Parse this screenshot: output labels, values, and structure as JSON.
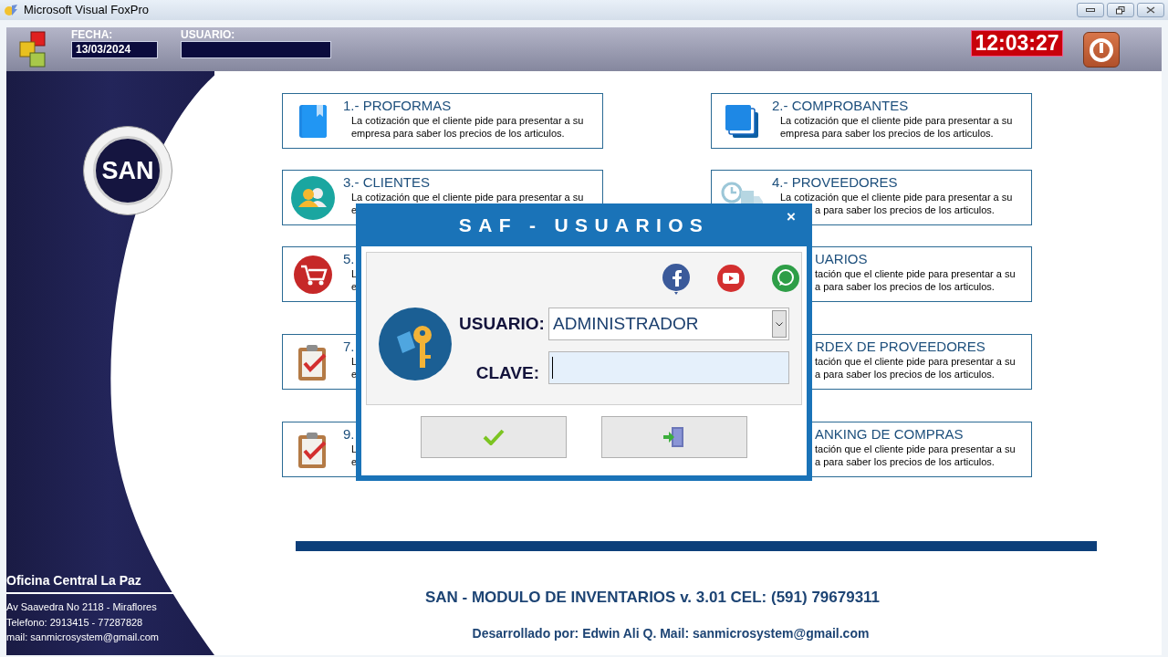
{
  "window": {
    "title": "Microsoft Visual FoxPro"
  },
  "header": {
    "date_label": "FECHA:",
    "date": "13/03/2024",
    "user_label": "USUARIO:",
    "clock": "12:03:27"
  },
  "menu_cards": [
    {
      "title": {
        "text": "1.- PROFORMAS"
      },
      "lines": [
        {
          "text": "La cotización que el cliente pide para presentar a su"
        },
        {
          "text": "empresa para saber los precios de los articulos."
        }
      ]
    },
    {
      "title": {
        "text": "2.- COMPROBANTES",
        "covered": false
      },
      "lines": [
        {
          "text": "La cotización que el cliente pide para presentar a su",
          "covered": false
        },
        {
          "text": "empresa para saber los precios de los articulos.",
          "covered": false
        }
      ]
    },
    {
      "title": {
        "text": "3.- CLIENTES"
      },
      "lines": [
        {
          "text": "La cotización que el cliente pide para presentar a su"
        },
        {
          "text": "e"
        }
      ]
    },
    {
      "title": {
        "text": "4.- PROVEEDORES",
        "covered": false
      },
      "lines": [
        {
          "text": "La cotización que el cliente pide para presentar a su",
          "covered": false
        },
        {
          "text": "a para saber los precios de los articulos.",
          "covered": true
        }
      ]
    },
    {
      "title": {
        "text": "5."
      },
      "lines": [
        {
          "text": "L"
        },
        {
          "text": "e"
        }
      ]
    },
    {
      "title": {
        "text": "UARIOS",
        "covered": true
      },
      "lines": [
        {
          "text": "tación que el cliente pide para presentar a su",
          "covered": true
        },
        {
          "text": "a para saber los precios de los articulos.",
          "covered": true
        }
      ]
    },
    {
      "title": {
        "text": "7."
      },
      "lines": [
        {
          "text": "L"
        },
        {
          "text": "e"
        }
      ]
    },
    {
      "title": {
        "text": "RDEX DE PROVEEDORES",
        "covered": true
      },
      "lines": [
        {
          "text": "tación que el cliente pide para presentar a su",
          "covered": true
        },
        {
          "text": "a para saber los precios de los articulos.",
          "covered": true
        }
      ]
    },
    {
      "title": {
        "text": "9."
      },
      "lines": [
        {
          "text": "L"
        },
        {
          "text": "e"
        }
      ]
    },
    {
      "title": {
        "text": "ANKING DE COMPRAS",
        "covered": true
      },
      "lines": [
        {
          "text": "tación que el cliente pide para presentar a su",
          "covered": true
        },
        {
          "text": "a para saber los precios de los articulos.",
          "covered": true
        }
      ]
    }
  ],
  "sidebar": {
    "logo_text": "SAN",
    "office": "Oficina Central La Paz",
    "address": "Av Saavedra No 2118 - Miraflores",
    "phone": "Telefono: 2913415 - 77287828",
    "mail": "mail: sanmicrosystem@gmail.com"
  },
  "footer": {
    "line_1": "SAN - MODULO DE INVENTARIOS v. 3.01  CEL: (591) 79679311",
    "line_2": "Desarrollado por: Edwin Ali Q. Mail: sanmicrosystem@gmail.com"
  },
  "dialog": {
    "title": "SAF - USUARIOS",
    "close": "×",
    "user_label": "USUARIO:",
    "user_value": "ADMINISTRADOR",
    "password_label": "CLAVE:"
  }
}
